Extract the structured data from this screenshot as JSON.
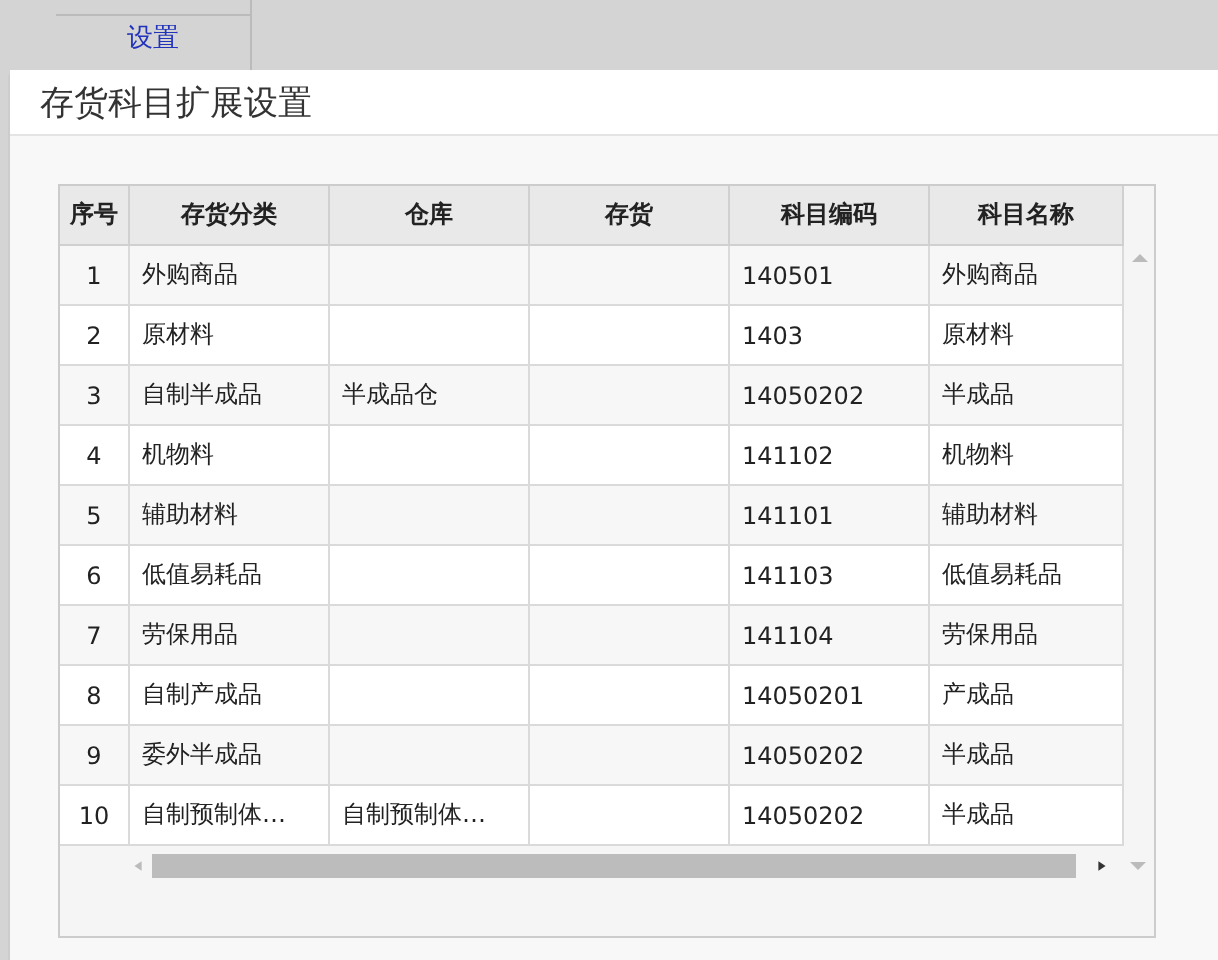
{
  "background": {
    "link": "设置"
  },
  "dialog": {
    "title": "存货科目扩展设置"
  },
  "table": {
    "columns": [
      "序号",
      "存货分类",
      "仓库",
      "存货",
      "科目编码",
      "科目名称"
    ],
    "rows": [
      [
        "1",
        "外购商品",
        "",
        "",
        "140501",
        "外购商品"
      ],
      [
        "2",
        "原材料",
        "",
        "",
        "1403",
        "原材料"
      ],
      [
        "3",
        "自制半成品",
        "半成品仓",
        "",
        "14050202",
        "半成品"
      ],
      [
        "4",
        "机物料",
        "",
        "",
        "141102",
        "机物料"
      ],
      [
        "5",
        "辅助材料",
        "",
        "",
        "141101",
        "辅助材料"
      ],
      [
        "6",
        "低值易耗品",
        "",
        "",
        "141103",
        "低值易耗品"
      ],
      [
        "7",
        "劳保用品",
        "",
        "",
        "141104",
        "劳保用品"
      ],
      [
        "8",
        "自制产成品",
        "",
        "",
        "14050201",
        "产成品"
      ],
      [
        "9",
        "委外半成品",
        "",
        "",
        "14050202",
        "半成品"
      ],
      [
        "10",
        "自制预制体…",
        "自制预制体…",
        "",
        "14050202",
        "半成品"
      ]
    ]
  }
}
